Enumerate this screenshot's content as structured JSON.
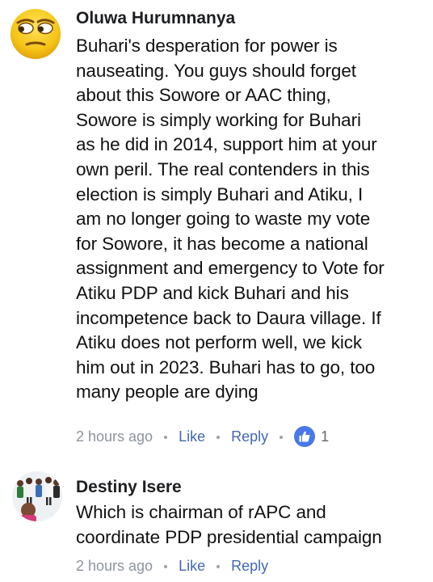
{
  "comments": [
    {
      "author": "Oluwa Hurumnanya",
      "avatar_icon": "emoji-unamused-face-icon",
      "lines": [
        "Buhari's desperation for power is",
        "nauseating. You guys should forget",
        "about this Sowore or AAC thing,",
        "Sowore is simply working for Buhari",
        "as he did in 2014, support him at your",
        "own peril. The real contenders in this",
        "election is simply Buhari and Atiku, I",
        "am no longer going to waste my vote",
        "for Sowore, it has become a national",
        "assignment and emergency to Vote for",
        "Atiku PDP and kick Buhari and his",
        "incompetence back to Daura village. If",
        "Atiku does not perform well, we kick",
        "him out in 2023. Buhari has to go, too",
        "many people are dying"
      ],
      "timestamp": "2 hours ago",
      "like_label": "Like",
      "reply_label": "Reply",
      "reaction_icon": "thumbs-up-icon",
      "reaction_count": "1"
    },
    {
      "author": "Destiny Isere",
      "avatar_icon": "group-photo-avatar",
      "lines": [
        "Which is chairman of rAPC and",
        "coordinate PDP presidential campaign"
      ],
      "timestamp": "2 hours ago",
      "like_label": "Like",
      "reply_label": "Reply"
    }
  ],
  "colors": {
    "link": "#4267b2",
    "meta": "#8d949e",
    "reaction_badge": "#4a78e8",
    "author": "#1c1e21"
  }
}
